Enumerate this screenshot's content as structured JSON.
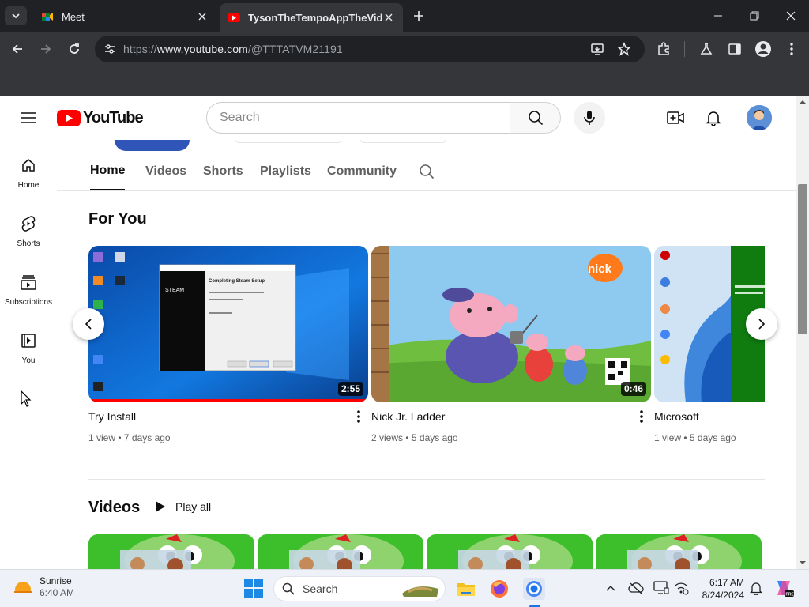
{
  "browser": {
    "tabs": [
      {
        "title": "Meet",
        "active": false
      },
      {
        "title": "TysonTheTempoAppTheVideoM",
        "active": true
      }
    ],
    "url_prefix": "https://",
    "url_host": "www.youtube.com",
    "url_path": "/@TTTATVM21191"
  },
  "youtube": {
    "logo_text": "YouTube",
    "search_placeholder": "Search",
    "guide": [
      {
        "label": "Home",
        "icon": "home-icon"
      },
      {
        "label": "Shorts",
        "icon": "shorts-icon"
      },
      {
        "label": "Subscriptions",
        "icon": "subscriptions-icon"
      },
      {
        "label": "You",
        "icon": "you-icon"
      }
    ],
    "channel_tabs": [
      "Home",
      "Videos",
      "Shorts",
      "Playlists",
      "Community"
    ],
    "active_tab": "Home",
    "for_you": {
      "title": "For You",
      "videos": [
        {
          "title": "Try Install",
          "meta": "1 view • 7 days ago",
          "duration": "2:55",
          "watched_fraction": 1.0
        },
        {
          "title": "Nick Jr. Ladder",
          "meta": "2 views • 5 days ago",
          "duration": "0:46"
        },
        {
          "title": "Microsoft",
          "meta": "1 view • 5 days ago",
          "duration": ""
        }
      ]
    },
    "videos_section": {
      "title": "Videos",
      "play_all": "Play all"
    }
  },
  "taskbar": {
    "weather_label": "Sunrise",
    "weather_time": "6:40 AM",
    "search_placeholder": "Search",
    "time": "6:17 AM",
    "date": "8/24/2024"
  },
  "colors": {
    "youtube_red": "#ff0000",
    "chrome_dark": "#202124",
    "chrome_toolbar": "#35363a"
  }
}
